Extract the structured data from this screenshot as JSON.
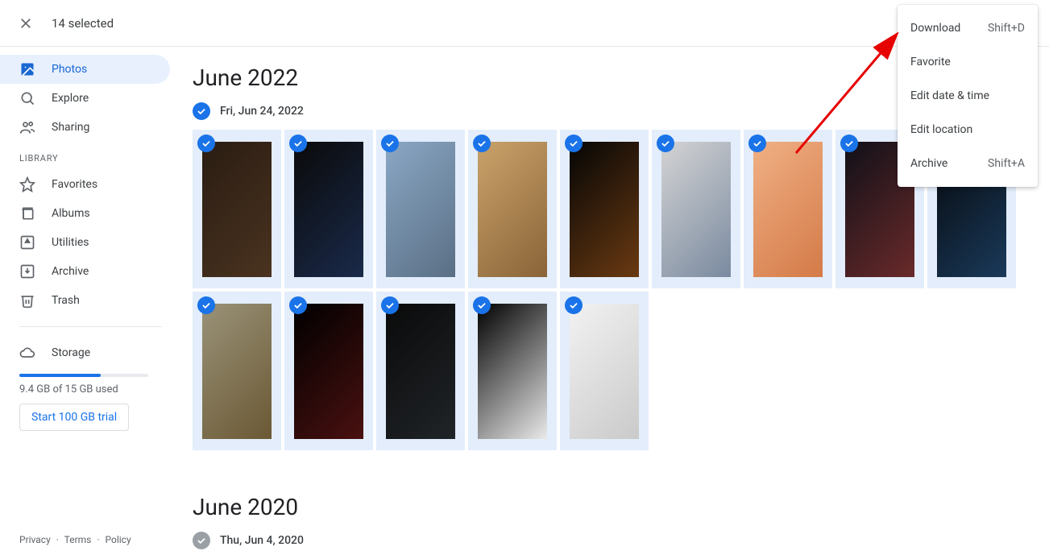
{
  "header": {
    "selected_count_label": "14 selected"
  },
  "sidebar": {
    "nav": [
      {
        "label": "Photos",
        "icon": "image-icon",
        "active": true
      },
      {
        "label": "Explore",
        "icon": "search-icon",
        "active": false
      },
      {
        "label": "Sharing",
        "icon": "people-icon",
        "active": false
      }
    ],
    "library_header": "LIBRARY",
    "library": [
      {
        "label": "Favorites",
        "icon": "star-icon"
      },
      {
        "label": "Albums",
        "icon": "album-icon"
      },
      {
        "label": "Utilities",
        "icon": "utilities-icon"
      },
      {
        "label": "Archive",
        "icon": "archive-icon"
      },
      {
        "label": "Trash",
        "icon": "trash-icon"
      }
    ],
    "storage": {
      "label": "Storage",
      "icon": "cloud-icon",
      "used_label": "9.4 GB of 15 GB used",
      "percent": 63,
      "trial_label": "Start 100 GB trial"
    },
    "footer": {
      "privacy": "Privacy",
      "terms": "Terms",
      "policy": "Policy"
    }
  },
  "main": {
    "sections": [
      {
        "title": "June 2022",
        "date_label": "Fri, Jun 24, 2022",
        "all_selected": true,
        "photos": [
          {
            "bg": "#2a1c12",
            "fg": "#4a3320"
          },
          {
            "bg": "#0a0a0a",
            "fg": "#1a2a4a"
          },
          {
            "bg": "#8aa7c4",
            "fg": "#5a6f85"
          },
          {
            "bg": "#caa26a",
            "fg": "#8a6438"
          },
          {
            "bg": "#050505",
            "fg": "#6a3a12"
          },
          {
            "bg": "#d4d4d4",
            "fg": "#7a8aa0"
          },
          {
            "bg": "#f0b084",
            "fg": "#d47a48"
          },
          {
            "bg": "#101018",
            "fg": "#6a2a2a"
          },
          {
            "bg": "#06080c",
            "fg": "#1a3a5a"
          },
          {
            "bg": "#9a9278",
            "fg": "#6a5834"
          },
          {
            "bg": "#000000",
            "fg": "#4a1010"
          },
          {
            "bg": "#0a0a0a",
            "fg": "#202428"
          },
          {
            "bg": "#000000",
            "fg": "#eaeaea"
          },
          {
            "bg": "#f2f2f2",
            "fg": "#cacaca"
          }
        ]
      },
      {
        "title": "June 2020",
        "date_label": "Thu, Jun 4, 2020",
        "all_selected": false,
        "photos": []
      }
    ]
  },
  "context_menu": {
    "items": [
      {
        "label": "Download",
        "shortcut": "Shift+D"
      },
      {
        "label": "Favorite",
        "shortcut": ""
      },
      {
        "label": "Edit date & time",
        "shortcut": ""
      },
      {
        "label": "Edit location",
        "shortcut": ""
      },
      {
        "label": "Archive",
        "shortcut": "Shift+A"
      }
    ]
  }
}
